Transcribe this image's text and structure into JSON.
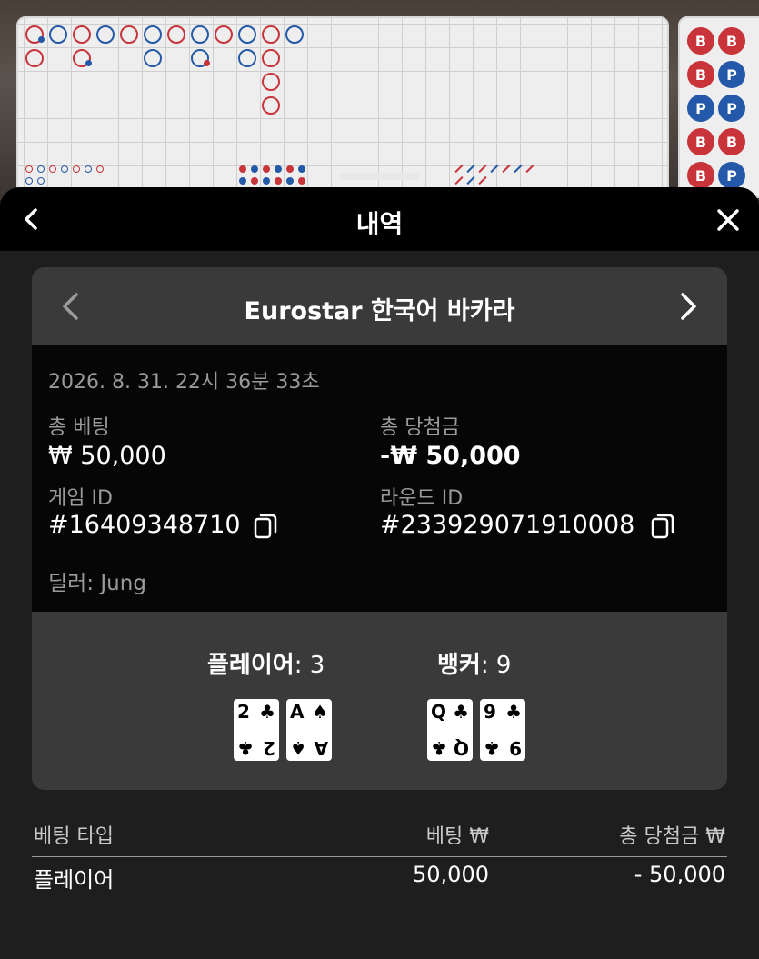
{
  "header": {
    "title": "내역"
  },
  "game": {
    "name": "Eurostar 한국어 바카라",
    "timestamp": "2026. 8. 31. 22시 36분 33초",
    "total_bet_label": "총 베팅",
    "total_bet_value": "₩ 50,000",
    "total_win_label": "총 당첨금",
    "total_win_value": "-₩ 50,000",
    "game_id_label": "게임 ID",
    "game_id_value": "#16409348710",
    "round_id_label": "라운드 ID",
    "round_id_value": "#233929071910008",
    "dealer": "딜러: Jung"
  },
  "hands": {
    "player_label": "플레이어",
    "player_score": ": 3",
    "banker_label": "뱅커",
    "banker_score": ": 9",
    "player_cards": [
      {
        "rank": "2",
        "suit": "♣"
      },
      {
        "rank": "A",
        "suit": "♠"
      }
    ],
    "banker_cards": [
      {
        "rank": "Q",
        "suit": "♣"
      },
      {
        "rank": "9",
        "suit": "♣"
      }
    ]
  },
  "bets_table": {
    "headers": [
      "베팅 타입",
      "베팅 ₩",
      "총 당첨금 ₩"
    ],
    "rows": [
      [
        "플레이어",
        "50,000",
        "- 50,000"
      ]
    ]
  },
  "roadmap": {
    "bead_plate": [
      "B",
      "B",
      "B",
      "P",
      "P",
      "P",
      "B",
      "B",
      "B",
      "P"
    ]
  },
  "colors": {
    "banker_red": "#c8343a",
    "player_blue": "#2458a8",
    "sheet_bg": "#1e1e1e",
    "card_bg": "#3a3a3a"
  }
}
